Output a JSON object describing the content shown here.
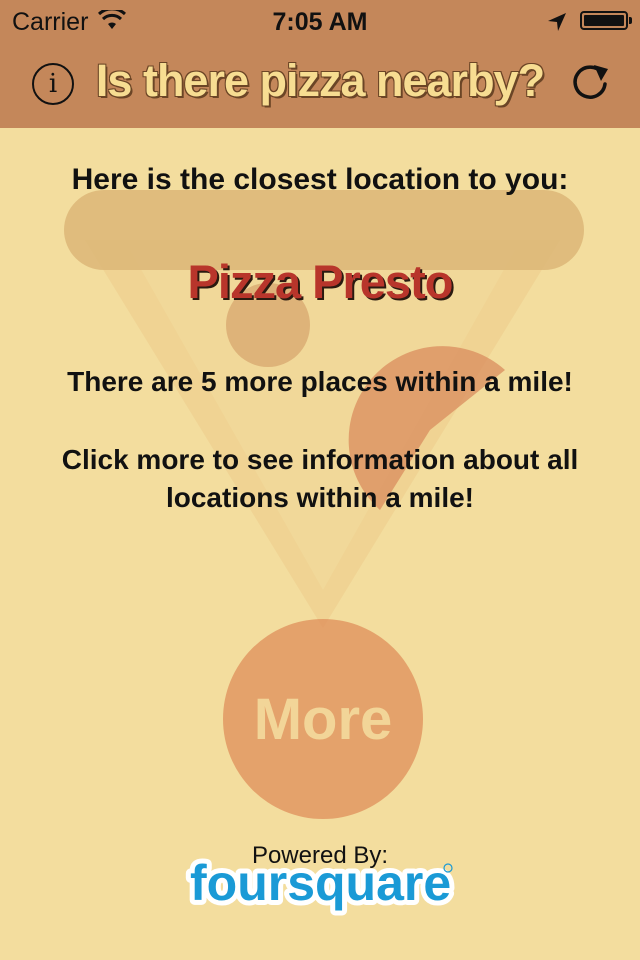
{
  "status_bar": {
    "carrier": "Carrier",
    "time": "7:05 AM"
  },
  "header": {
    "title": "Is there pizza nearby?",
    "info_symbol": "i",
    "info_icon": "info-icon",
    "refresh_icon": "refresh-icon"
  },
  "main": {
    "headline": "Here is the closest location to you:",
    "place_name": "Pizza Presto",
    "more_count": "There are 5 more places within a mile!",
    "click_more": "Click more to see information about all locations within a mile!",
    "more_label": "More"
  },
  "footer": {
    "powered_by": "Powered By:",
    "brand": "foursquare"
  },
  "colors": {
    "header_bg": "#c4875a",
    "page_bg": "#f3dd9e",
    "title_text": "#f7dd92",
    "place_text": "#b8352b",
    "more_button": "#de8b58",
    "brand_blue": "#1a9ad6"
  }
}
